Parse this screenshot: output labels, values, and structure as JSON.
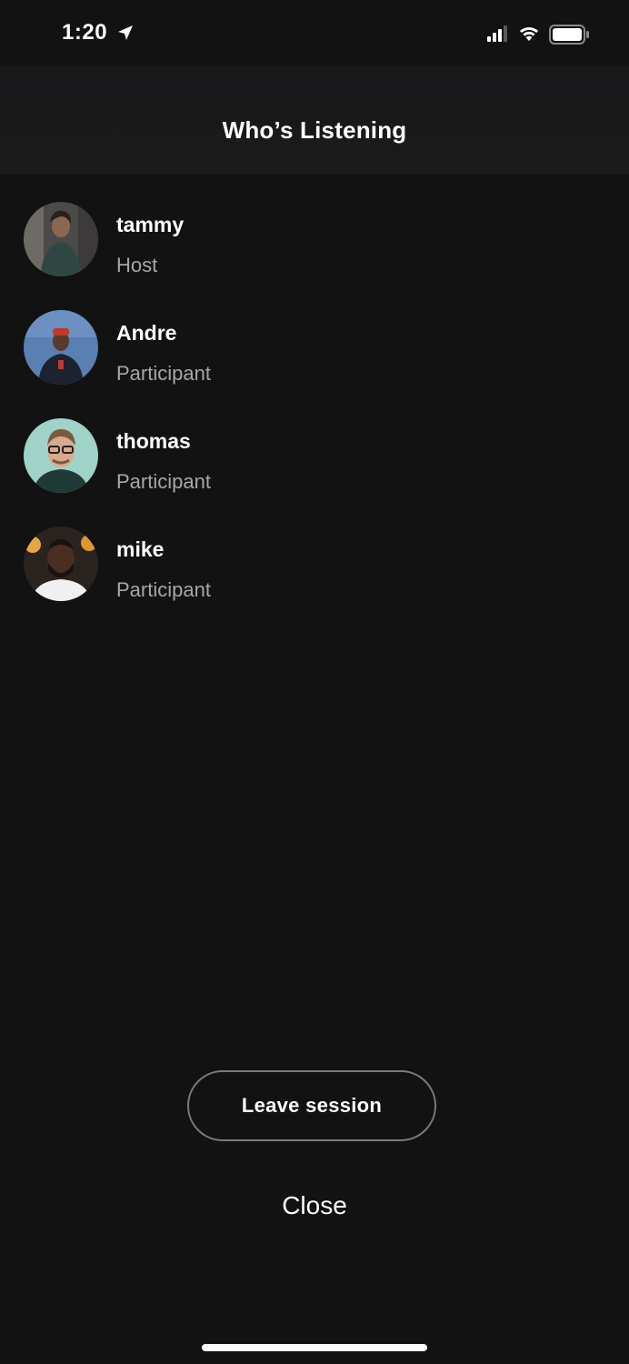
{
  "status_bar": {
    "time": "1:20",
    "icons": [
      "location-arrow-icon",
      "cellular-signal-icon",
      "wifi-icon",
      "battery-icon"
    ]
  },
  "header": {
    "title": "Who’s Listening"
  },
  "listeners": [
    {
      "name": "tammy",
      "role": "Host",
      "avatar": "tammy-avatar"
    },
    {
      "name": "Andre",
      "role": "Participant",
      "avatar": "andre-avatar"
    },
    {
      "name": "thomas",
      "role": "Participant",
      "avatar": "thomas-avatar"
    },
    {
      "name": "mike",
      "role": "Participant",
      "avatar": "mike-avatar"
    }
  ],
  "actions": {
    "leave_label": "Leave session",
    "close_label": "Close"
  },
  "colors": {
    "background": "#121212",
    "header": "#1b1b1b",
    "primary_text": "#ffffff",
    "secondary_text": "#a7a7a7",
    "button_border": "#7a7a7a"
  }
}
